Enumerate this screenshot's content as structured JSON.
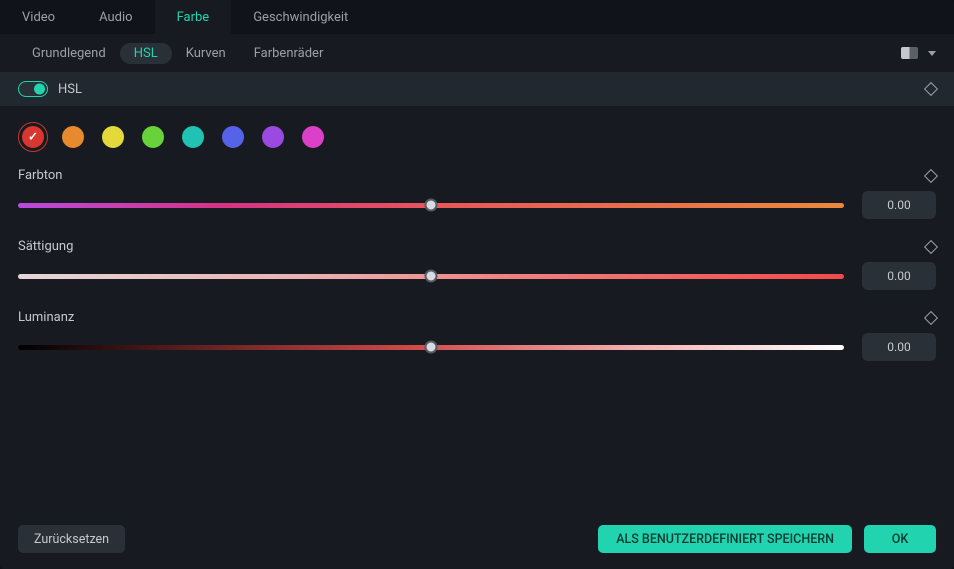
{
  "topTabs": {
    "video": "Video",
    "audio": "Audio",
    "farbe": "Farbe",
    "speed": "Geschwindigkeit",
    "active": "farbe"
  },
  "subTabs": {
    "basic": "Grundlegend",
    "hsl": "HSL",
    "curves": "Kurven",
    "wheels": "Farbenräder",
    "active": "hsl"
  },
  "section": {
    "title": "HSL",
    "enabled": true
  },
  "swatches": [
    {
      "name": "red",
      "color": "#d9362f",
      "selected": true
    },
    {
      "name": "orange",
      "color": "#e78a2e",
      "selected": false
    },
    {
      "name": "yellow",
      "color": "#e3d93a",
      "selected": false
    },
    {
      "name": "green",
      "color": "#67d23a",
      "selected": false
    },
    {
      "name": "cyan",
      "color": "#1fc2b3",
      "selected": false
    },
    {
      "name": "blue",
      "color": "#5663e8",
      "selected": false
    },
    {
      "name": "purple",
      "color": "#9a4ae0",
      "selected": false
    },
    {
      "name": "magenta",
      "color": "#dc3fc8",
      "selected": false
    }
  ],
  "sliders": {
    "hue": {
      "label": "Farbton",
      "value": "0.00"
    },
    "sat": {
      "label": "Sättigung",
      "value": "0.00"
    },
    "lum": {
      "label": "Luminanz",
      "value": "0.00"
    }
  },
  "footer": {
    "reset": "Zurücksetzen",
    "savePreset": "ALS BENUTZERDEFINIERT SPEICHERN",
    "ok": "OK"
  }
}
